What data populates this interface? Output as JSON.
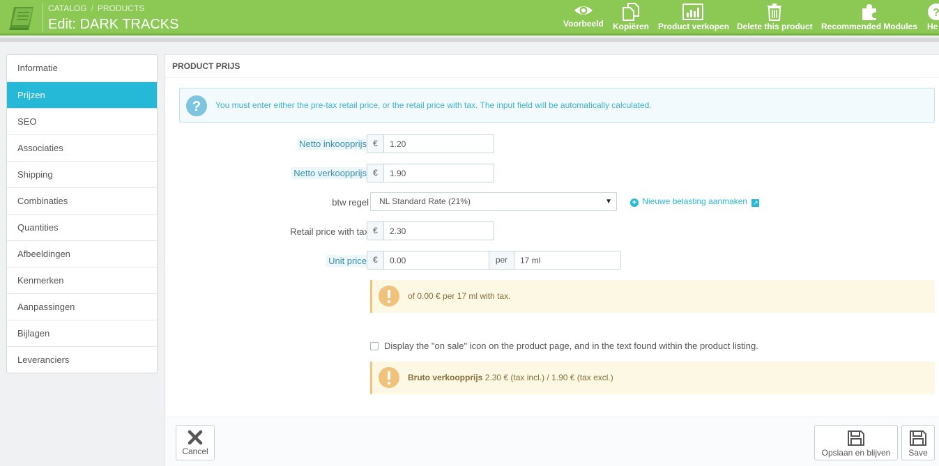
{
  "header": {
    "breadcrumb": [
      "CATALOG",
      "PRODUCTS"
    ],
    "breadcrumb_sep": "/",
    "title": "Edit: DARK TRACKS",
    "toolbar": {
      "preview": "Voorbeeld",
      "duplicate": "Kopiëren",
      "sales": "Product verkopen",
      "delete": "Delete this product",
      "modules": "Recommended Modules",
      "help": "He"
    }
  },
  "sidebar": {
    "tabs": [
      "Informatie",
      "Prijzen",
      "SEO",
      "Associaties",
      "Shipping",
      "Combinaties",
      "Quantities",
      "Afbeeldingen",
      "Kenmerken",
      "Aanpassingen",
      "Bijlagen",
      "Leveranciers"
    ],
    "active": "Prijzen"
  },
  "panel": {
    "heading": "PRODUCT PRIJS",
    "info": "You must enter either the pre-tax retail price, or the retail price with tax. The input field will be automatically calculated.",
    "currency": "€",
    "wholesale_label": "Netto inkoopprijs",
    "wholesale_value": "1.20",
    "pretax_label": "Netto verkoopprijs",
    "pretax_value": "1.90",
    "tax_rule_label": "btw regel",
    "tax_rule_value": "NL Standard Rate (21%)",
    "new_tax_link": "Nieuwe belasting aanmaken",
    "retail_label": "Retail price with tax",
    "retail_value": "2.30",
    "unit_label": "Unit price",
    "unit_value": "0.00",
    "per_label": "per",
    "unit_qty": "17 ml",
    "unit_note": "of 0.00 € per 17 ml with tax.",
    "onsale_text": "Display the \"on sale\" icon on the product page, and in the text found within the product listing.",
    "onsale_checked": false,
    "final_price_label": "Bruto verkoopprijs",
    "final_price_text": "2.30 € (tax incl.) / 1.90 € (tax excl.)"
  },
  "footer": {
    "cancel": "Cancel",
    "save_stay": "Opslaan en blijven",
    "save": "Save"
  },
  "colors": {
    "header": "#8bc954",
    "accent": "#25b9d7",
    "warning_bg": "#fcf8e3",
    "warning_icon": "#f0c27b"
  }
}
